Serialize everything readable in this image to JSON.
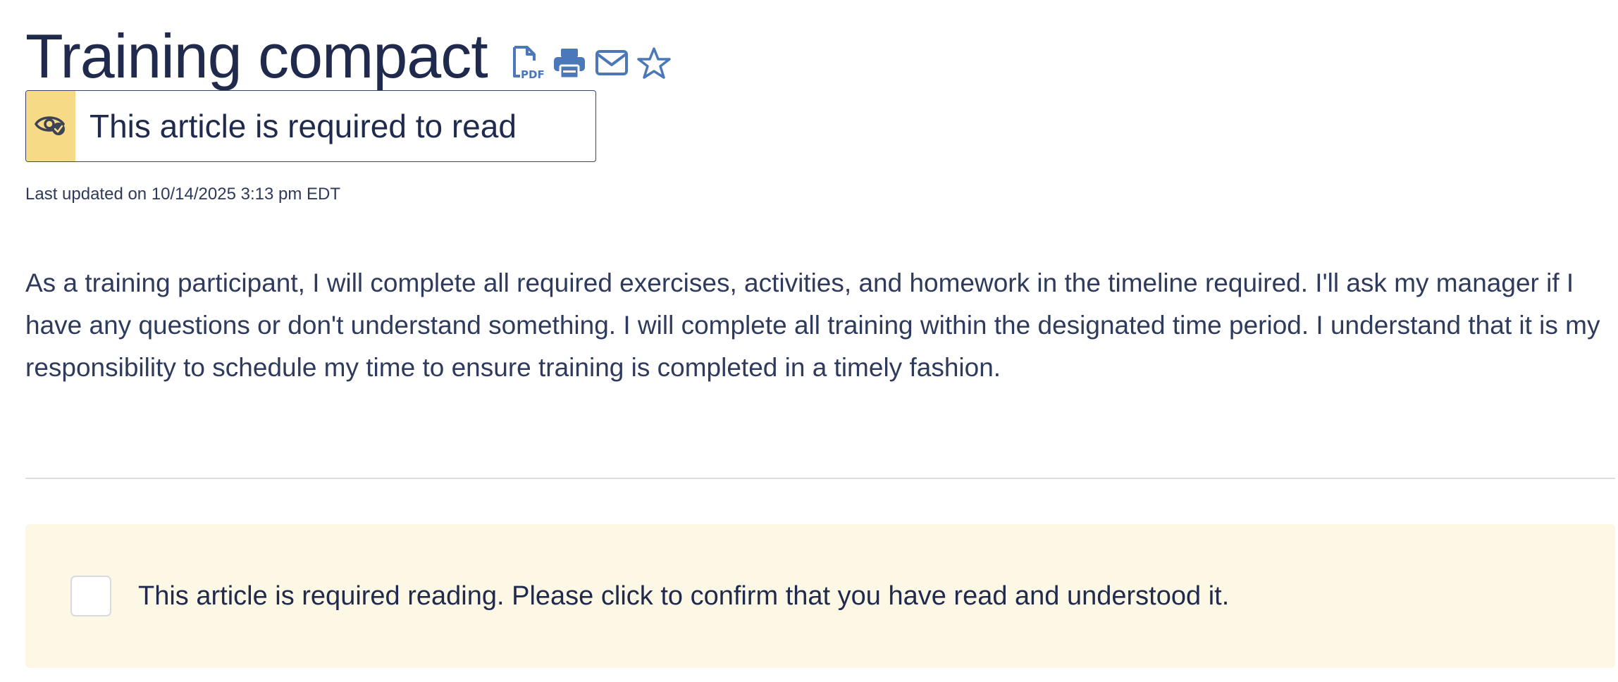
{
  "article": {
    "title": "Training compact",
    "actions": [
      {
        "icon": "pdf-icon",
        "label": "PDF"
      },
      {
        "icon": "print-icon"
      },
      {
        "icon": "email-icon"
      },
      {
        "icon": "star-icon"
      }
    ],
    "required_badge": {
      "icon": "eye-check-icon",
      "text": "This article is required to read"
    },
    "last_updated": "Last updated on 10/14/2025 3:13 pm EDT",
    "body": "As a training participant, I will complete all required exercises, activities, and homework in the timeline required. I'll ask my manager if I have any questions or don't understand something. I will complete all training within the designated time period. I understand that it is my responsibility to schedule my time to ensure training is completed in a timely fashion."
  },
  "confirmation": {
    "checked": false,
    "text": "This article is required reading. Please click to confirm that you have read and understood it."
  },
  "colors": {
    "text": "#1f2a4d",
    "icon": "#4a78b8",
    "badge_bg": "#f6da86",
    "confirm_bg": "#fdf7e6"
  }
}
